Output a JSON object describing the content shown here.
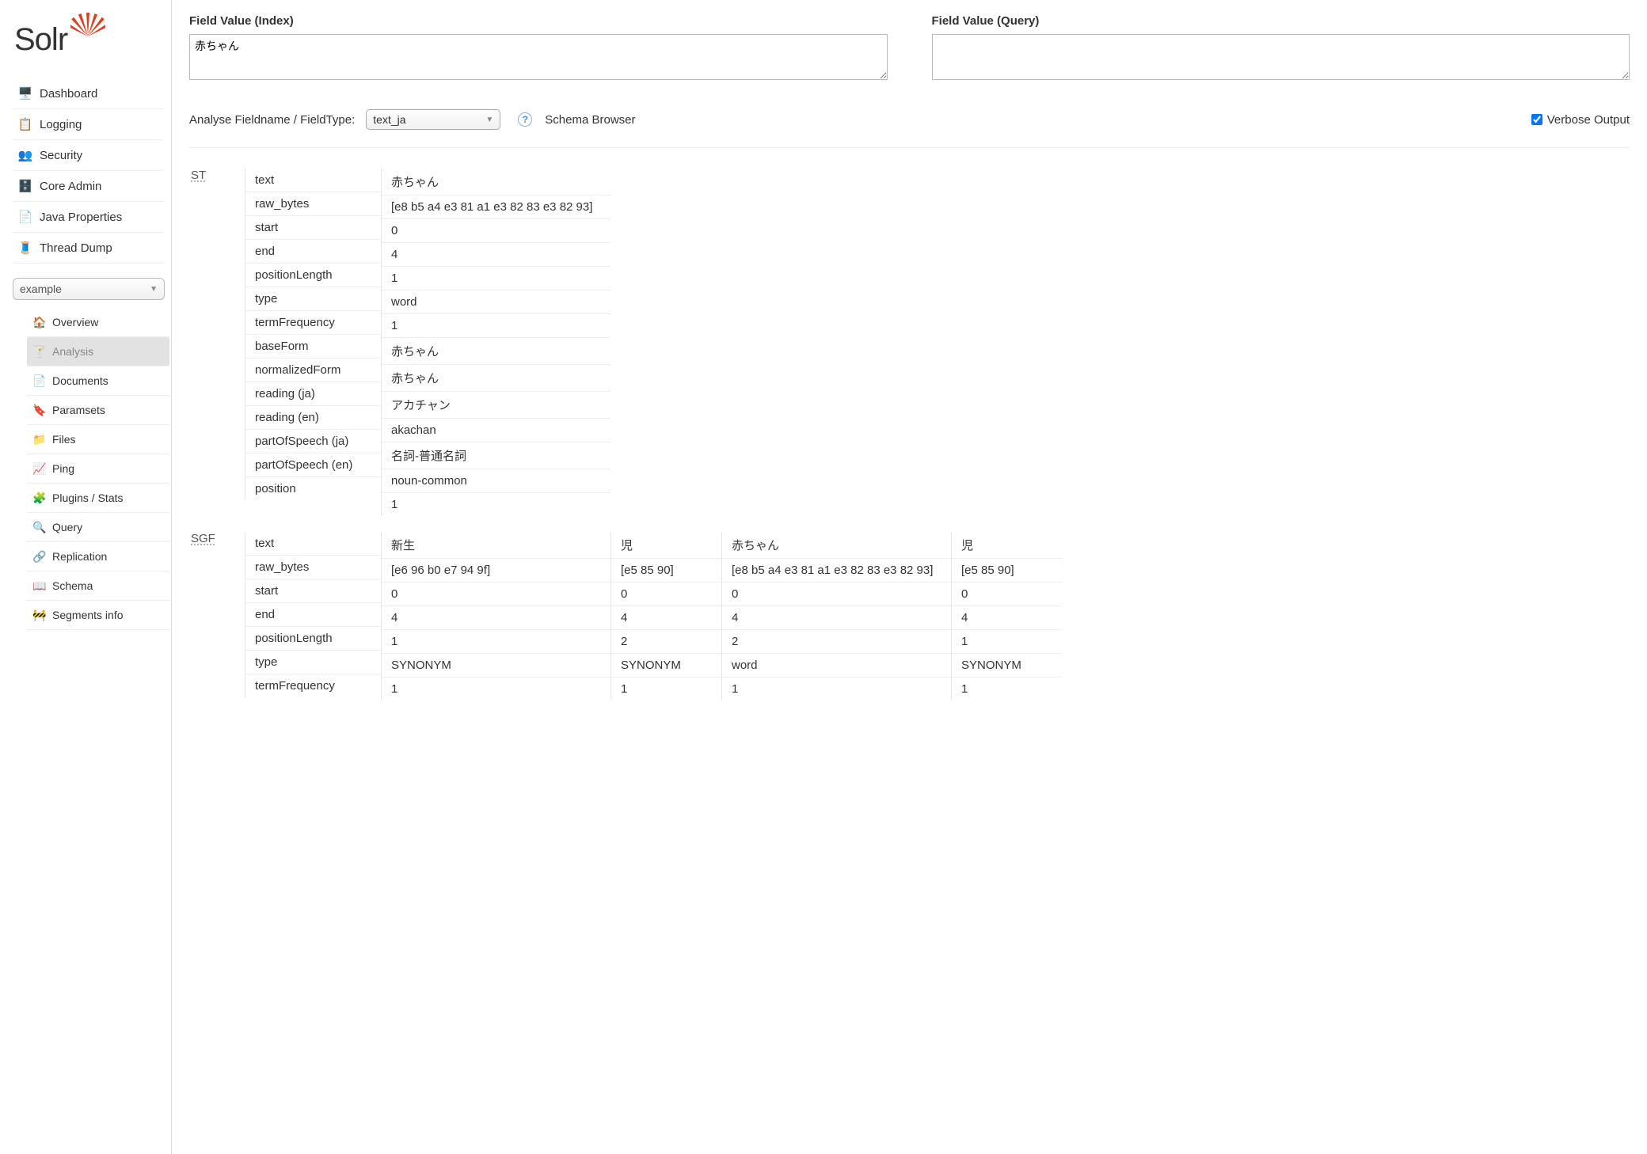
{
  "logo": {
    "text": "Solr"
  },
  "nav": [
    {
      "key": "dashboard",
      "label": "Dashboard",
      "icon": "🖥️"
    },
    {
      "key": "logging",
      "label": "Logging",
      "icon": "📋"
    },
    {
      "key": "security",
      "label": "Security",
      "icon": "👥"
    },
    {
      "key": "coreadmin",
      "label": "Core Admin",
      "icon": "🗄️"
    },
    {
      "key": "javaprops",
      "label": "Java Properties",
      "icon": "📄"
    },
    {
      "key": "threaddump",
      "label": "Thread Dump",
      "icon": "🧵"
    }
  ],
  "core_select": {
    "value": "example"
  },
  "subnav": [
    {
      "key": "overview",
      "label": "Overview",
      "icon": "🏠",
      "active": false
    },
    {
      "key": "analysis",
      "label": "Analysis",
      "icon": "🍸",
      "active": true
    },
    {
      "key": "documents",
      "label": "Documents",
      "icon": "📄",
      "active": false
    },
    {
      "key": "paramsets",
      "label": "Paramsets",
      "icon": "🔖",
      "active": false
    },
    {
      "key": "files",
      "label": "Files",
      "icon": "📁",
      "active": false
    },
    {
      "key": "ping",
      "label": "Ping",
      "icon": "📈",
      "active": false
    },
    {
      "key": "plugins",
      "label": "Plugins / Stats",
      "icon": "🧩",
      "active": false
    },
    {
      "key": "query",
      "label": "Query",
      "icon": "🔍",
      "active": false
    },
    {
      "key": "replication",
      "label": "Replication",
      "icon": "🔗",
      "active": false
    },
    {
      "key": "schema",
      "label": "Schema",
      "icon": "📖",
      "active": false
    },
    {
      "key": "segments",
      "label": "Segments info",
      "icon": "🚧",
      "active": false
    }
  ],
  "fields": {
    "index_label": "Field Value (Index)",
    "index_value": "赤ちゃん",
    "query_label": "Field Value (Query)",
    "query_value": ""
  },
  "controls": {
    "analyse_label": "Analyse Fieldname / FieldType:",
    "fieldtype_value": "text_ja",
    "schema_browser": "Schema Browser",
    "verbose_label": "Verbose Output",
    "verbose_checked": true
  },
  "keys_full": [
    "text",
    "raw_bytes",
    "start",
    "end",
    "positionLength",
    "type",
    "termFrequency",
    "baseForm",
    "normalizedForm",
    "reading (ja)",
    "reading (en)",
    "partOfSpeech (ja)",
    "partOfSpeech (en)",
    "position"
  ],
  "keys_partial": [
    "text",
    "raw_bytes",
    "start",
    "end",
    "positionLength",
    "type",
    "termFrequency"
  ],
  "stages": [
    {
      "name": "ST",
      "keys": "full",
      "tokens": [
        {
          "wide": true,
          "values": [
            "赤ちゃん",
            "[e8 b5 a4 e3 81 a1 e3 82 83 e3 82 93]",
            "0",
            "4",
            "1",
            "word",
            "1",
            "赤ちゃん",
            "赤ちゃん",
            "アカチャン",
            "akachan",
            "名詞-普通名詞",
            "noun-common",
            "1"
          ]
        }
      ]
    },
    {
      "name": "SGF",
      "keys": "partial",
      "tokens": [
        {
          "wide": true,
          "values": [
            "新生",
            "[e6 96 b0 e7 94 9f]",
            "0",
            "4",
            "1",
            "SYNONYM",
            "1"
          ]
        },
        {
          "wide": false,
          "values": [
            "児",
            "[e5 85 90]",
            "0",
            "4",
            "2",
            "SYNONYM",
            "1"
          ]
        },
        {
          "wide": true,
          "values": [
            "赤ちゃん",
            "[e8 b5 a4 e3 81 a1 e3 82 83 e3 82 93]",
            "0",
            "4",
            "2",
            "word",
            "1"
          ]
        },
        {
          "wide": false,
          "values": [
            "児",
            "[e5 85 90]",
            "0",
            "4",
            "1",
            "SYNONYM",
            "1"
          ]
        }
      ]
    }
  ]
}
